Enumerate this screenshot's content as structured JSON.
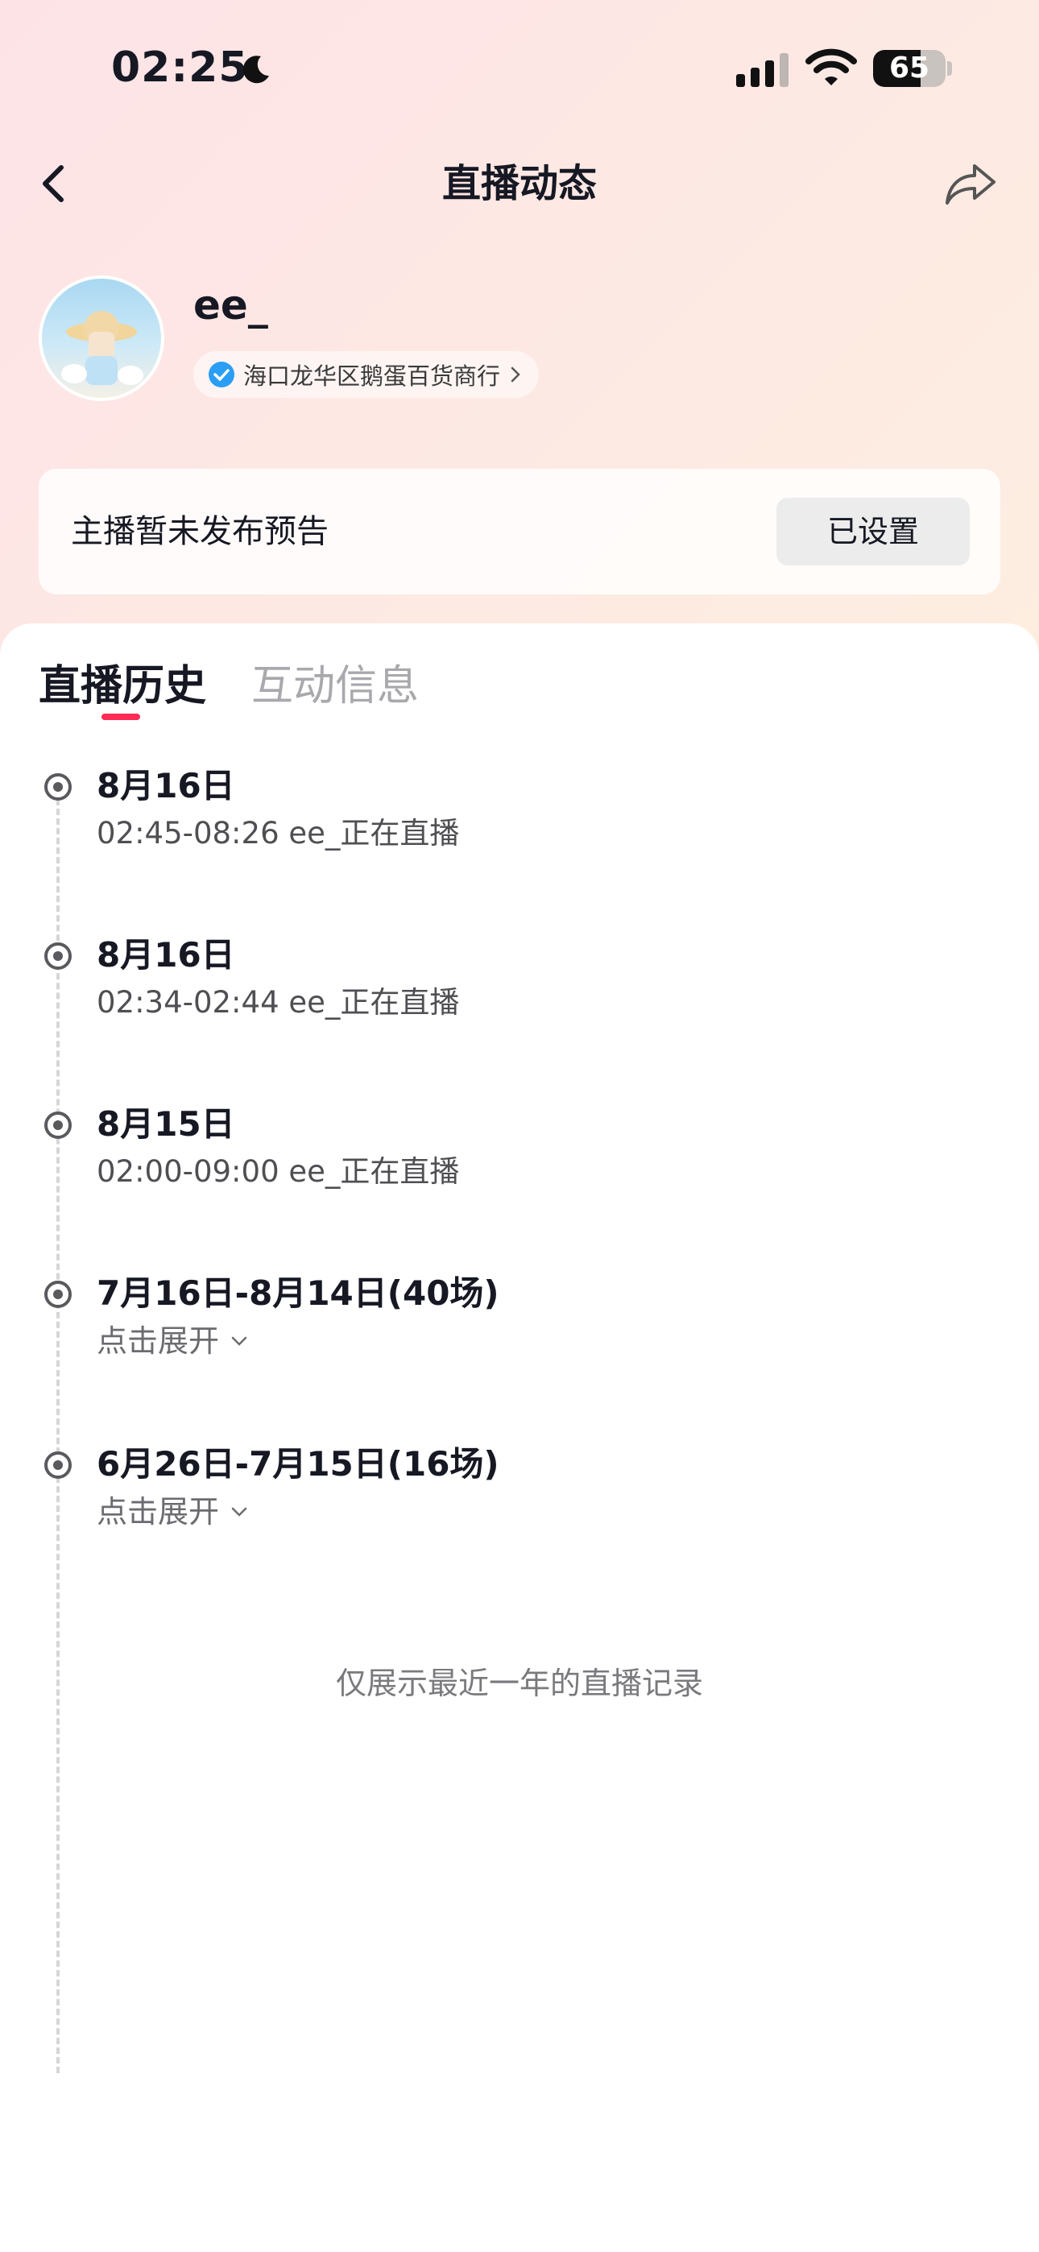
{
  "status_bar": {
    "time": "02:25",
    "battery": "65",
    "battery_level": 0.65
  },
  "nav": {
    "title": "直播动态"
  },
  "profile": {
    "username": "ee_",
    "shop": "海口龙华区鹅蛋百货商行"
  },
  "notice": {
    "text": "主播暂未发布预告",
    "button": "已设置"
  },
  "tabs": [
    {
      "label": "直播历史",
      "active": true
    },
    {
      "label": "互动信息",
      "active": false
    }
  ],
  "history": [
    {
      "date": "8月16日",
      "detail": "02:45-08:26 ee_正在直播"
    },
    {
      "date": "8月16日",
      "detail": "02:34-02:44 ee_正在直播"
    },
    {
      "date": "8月15日",
      "detail": "02:00-09:00 ee_正在直播"
    },
    {
      "date": "7月16日-8月14日(40场)",
      "detail": "点击展开"
    },
    {
      "date": "6月26日-7月15日(16场)",
      "detail": "点击展开"
    }
  ],
  "footer_note": "仅展示最近一年的直播记录",
  "colors": {
    "accent": "#fe2c55",
    "verified": "#2a9df4"
  },
  "icons": [
    "moon-icon",
    "cellular-signal-icon",
    "wifi-icon",
    "battery-icon",
    "back-icon",
    "share-icon",
    "verified-icon",
    "chevron-right-icon",
    "chevron-down-icon"
  ]
}
